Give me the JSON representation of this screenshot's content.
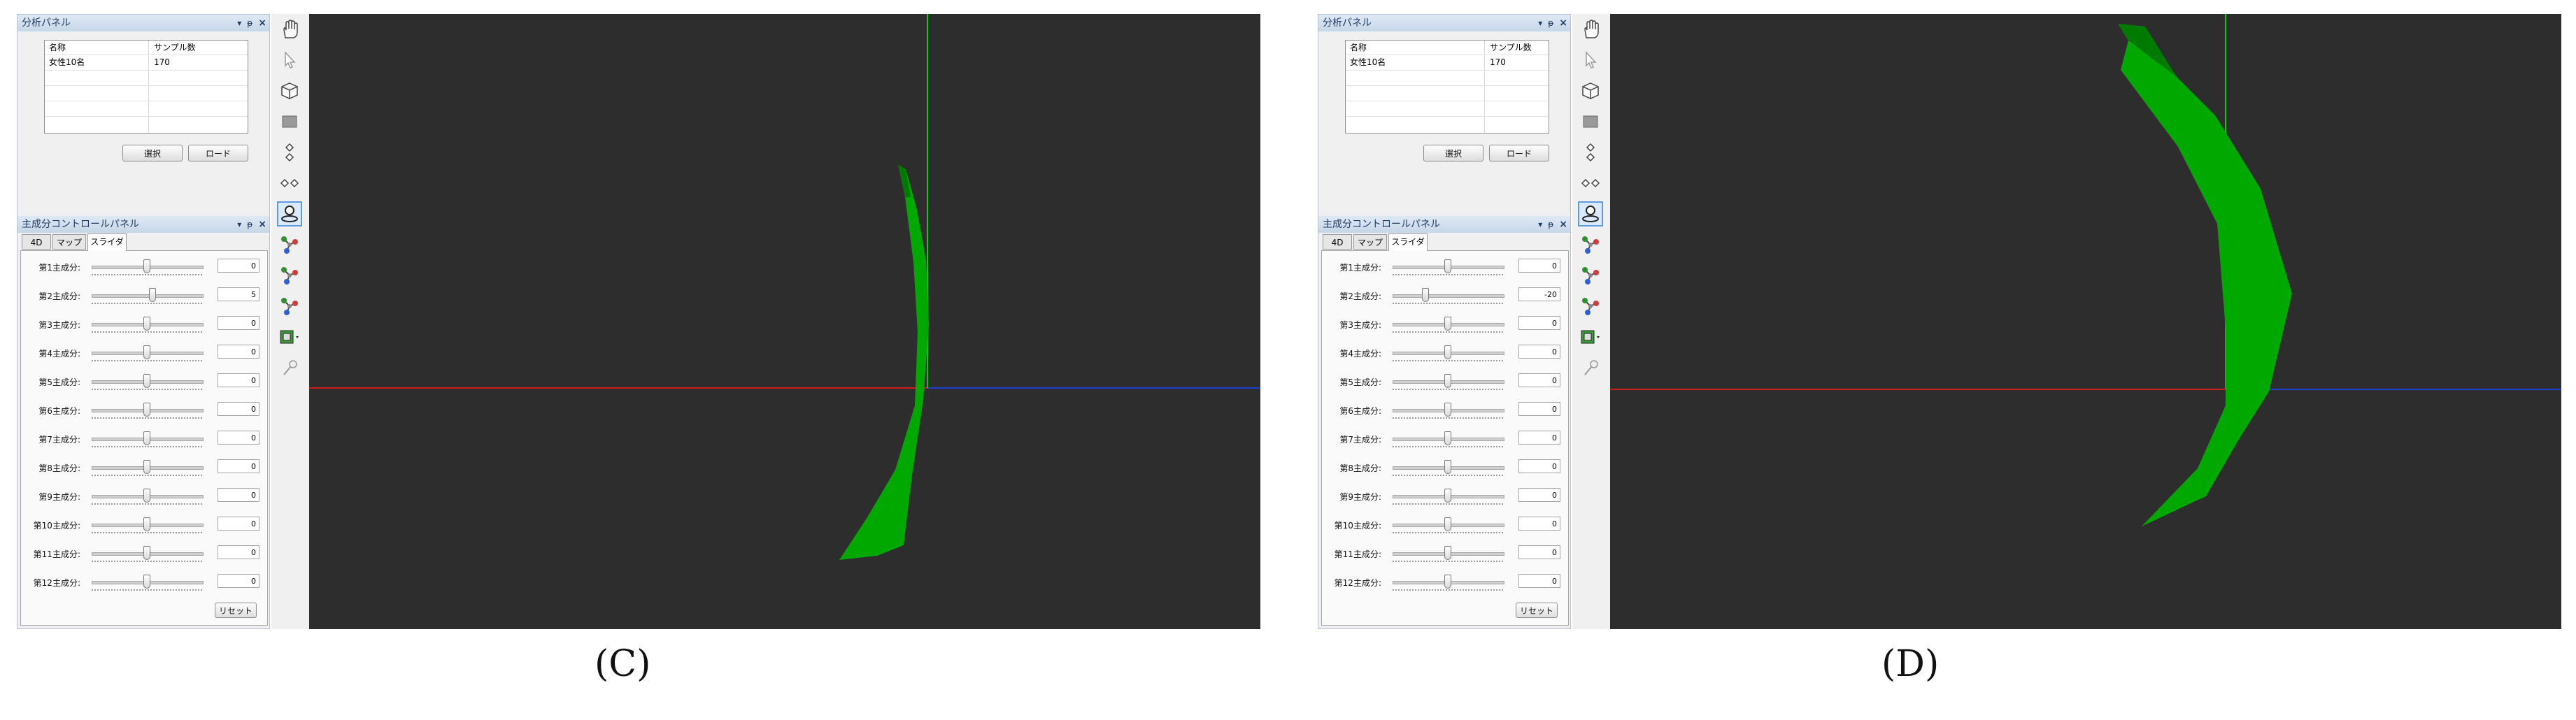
{
  "panels": [
    {
      "analysis_panel_title": "分析パネル",
      "table": {
        "columns": [
          "名称",
          "サンプル数"
        ],
        "rows": [
          [
            "女性10名",
            "170"
          ]
        ]
      },
      "buttons": {
        "select": "選択",
        "load": "ロード",
        "reset": "リセット"
      },
      "control_panel_title": "主成分コントロールパネル",
      "tabs": [
        "4D",
        "マップ",
        "スライダ"
      ],
      "active_tab": "スライダ",
      "sliders": [
        {
          "label": "第1主成分:",
          "value": "0",
          "level": 0.5
        },
        {
          "label": "第2主成分:",
          "value": "5",
          "level": 0.55
        },
        {
          "label": "第3主成分:",
          "value": "0",
          "level": 0.5
        },
        {
          "label": "第4主成分:",
          "value": "0",
          "level": 0.5
        },
        {
          "label": "第5主成分:",
          "value": "0",
          "level": 0.5
        },
        {
          "label": "第6主成分:",
          "value": "0",
          "level": 0.5
        },
        {
          "label": "第7主成分:",
          "value": "0",
          "level": 0.5
        },
        {
          "label": "第8主成分:",
          "value": "0",
          "level": 0.5
        },
        {
          "label": "第9主成分:",
          "value": "0",
          "level": 0.5
        },
        {
          "label": "第10主成分:",
          "value": "0",
          "level": 0.5
        },
        {
          "label": "第11主成分:",
          "value": "0",
          "level": 0.5
        },
        {
          "label": "第12主成分:",
          "value": "0",
          "level": 0.5
        }
      ],
      "caption": "(C)"
    },
    {
      "analysis_panel_title": "分析パネル",
      "table": {
        "columns": [
          "名称",
          "サンプル数"
        ],
        "rows": [
          [
            "女性10名",
            "170"
          ]
        ]
      },
      "buttons": {
        "select": "選択",
        "load": "ロード",
        "reset": "リセット"
      },
      "control_panel_title": "主成分コントロールパネル",
      "tabs": [
        "4D",
        "マップ",
        "スライダ"
      ],
      "active_tab": "スライダ",
      "sliders": [
        {
          "label": "第1主成分:",
          "value": "0",
          "level": 0.5
        },
        {
          "label": "第2主成分:",
          "value": "-20",
          "level": 0.3
        },
        {
          "label": "第3主成分:",
          "value": "0",
          "level": 0.5
        },
        {
          "label": "第4主成分:",
          "value": "0",
          "level": 0.5
        },
        {
          "label": "第5主成分:",
          "value": "0",
          "level": 0.5
        },
        {
          "label": "第6主成分:",
          "value": "0",
          "level": 0.5
        },
        {
          "label": "第7主成分:",
          "value": "0",
          "level": 0.5
        },
        {
          "label": "第8主成分:",
          "value": "0",
          "level": 0.5
        },
        {
          "label": "第9主成分:",
          "value": "0",
          "level": 0.5
        },
        {
          "label": "第10主成分:",
          "value": "0",
          "level": 0.5
        },
        {
          "label": "第11主成分:",
          "value": "0",
          "level": 0.5
        },
        {
          "label": "第12主成分:",
          "value": "0",
          "level": 0.5
        }
      ],
      "caption": "(D)"
    }
  ],
  "toolbar_icons": [
    "hand-icon",
    "pointer-icon",
    "cube-icon",
    "square-icon",
    "vertical-nodes-icon",
    "horizontal-nodes-icon",
    "head-profile-icon",
    "molecule-icon",
    "molecule-icon",
    "molecule-icon",
    "layers-icon",
    "pin-icon"
  ],
  "colors": {
    "viewport_bg": "#2d2d2d",
    "shape_fill": "#00a800",
    "axis_x": "#d11a1a",
    "axis_y": "#1fbf1f",
    "axis_z": "#1a3fd1"
  }
}
